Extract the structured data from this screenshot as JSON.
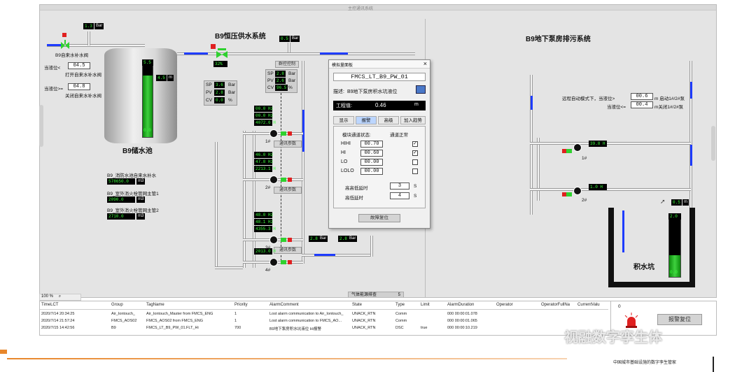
{
  "window": {
    "title": "主控通讯系统"
  },
  "left_section": {
    "title": "B9恒压供水系统",
    "tank_label": "B9储水池",
    "tank_level_big": "5.5",
    "tank_level_side": "4.5",
    "tank_level_side_unit": "m",
    "tank_bottom_value": "0.0",
    "tank_fill": 0.8,
    "inlet_pressure": "1.3",
    "inlet_pressure_unit": "Bar",
    "inlet_valve_label": "B9自来水补水阀",
    "open_level_prefix": "当液位<",
    "open_level_value": "04.5",
    "open_level_desc": "打开自来水补水阀",
    "close_level_prefix": "当液位>=",
    "close_level_value": "04.8",
    "close_level_desc": "关闭自来水补水阀",
    "main_valve_open": "32%",
    "outlet_pressure": "0.5",
    "outlet_pressure_unit": "Bar",
    "sp_label": "SP",
    "sp_value": "3.6",
    "sp_unit": "Bar",
    "pv_label": "PV",
    "pv_value": "2.8",
    "pv_unit": "Bar",
    "cv_label": "CV",
    "cv_value": "0.0",
    "cv_unit": "%",
    "panel2_title": "群控控制",
    "sp2_value": "2.8",
    "sp2_unit": "Bar",
    "pv2_value": "2.6",
    "pv2_unit": "Bar",
    "cv2_value": "96.5",
    "cv2_unit": "%",
    "meters": [
      {
        "label": "B9_消防水池自来水补水",
        "value": "578650.0",
        "unit": "m3"
      },
      {
        "label": "B9_室外消火栓管网主管1",
        "value": "2090.0",
        "unit": "m3"
      },
      {
        "label": "B9_室外消火栓管网主管2",
        "value": "2710.0",
        "unit": "m3"
      }
    ],
    "pumps": [
      {
        "id": "1#",
        "hz1": "00.0 Hz",
        "hz2": "00.0 Hz",
        "hours": "4072.6 H",
        "btn": "通讯参数"
      },
      {
        "id": "2#",
        "hz1": "46.0 Hz",
        "hz2": "47.8 Hz",
        "hours": "2213.1 H",
        "btn": "通讯参数"
      },
      {
        "id": "3#",
        "hz1": "48.0 Hz",
        "hz2": "48.1 Hz",
        "hours": "4355.3 H",
        "btn": "通讯参数"
      },
      {
        "id": "4#",
        "hz1": "",
        "hz2": "",
        "hours": "2013.0 H",
        "btn": ""
      }
    ],
    "bottom_pressure1": "2.8",
    "bottom_pressure1_unit": "Bar",
    "bottom_pressure2": "2.8",
    "bottom_pressure2_unit": "Bar",
    "energy_label": "气体能源排查",
    "energy_num": "5"
  },
  "dialog": {
    "title": "模拟量面板",
    "tag": "FMCS_LT_B9_PW_01",
    "desc_label": "描述:",
    "desc_value": "B9地下泵房积水坑液位",
    "eng_label": "工程值:",
    "eng_value": "0.46",
    "eng_unit": "m",
    "tabs": [
      "显示",
      "报警",
      "高级",
      "加入趋势"
    ],
    "status_label": "模块通道状态:",
    "status_value": "通道正常",
    "rows": [
      {
        "label": "HIHI",
        "value": "00.70",
        "checked": "✓"
      },
      {
        "label": "HI",
        "value": "00.60",
        "checked": "✓"
      },
      {
        "label": "LO",
        "value": "00.00",
        "checked": ""
      },
      {
        "label": "LOLO",
        "value": "00.00",
        "checked": ""
      }
    ],
    "delay_high_label": "高高低延时",
    "delay_high_value": "3",
    "delay_low_label": "高低延时",
    "delay_low_value": "4",
    "delay_unit": "S",
    "reset_btn": "故障复位",
    "close": "×"
  },
  "right_section": {
    "title": "B9地下泵房排污系统",
    "mode_text": "远程自动模式下，当液位>",
    "mode_value1": "00.6",
    "mode_desc1": "m 启动1#/2#泵",
    "mode_text2": "当液位<=",
    "mode_value2": "00.4",
    "mode_desc2": "m关闭1#/2#泵",
    "pump1_hours": "39.8 H",
    "pump1_id": "1#",
    "pump2_hours": "1.0 H",
    "pump2_id": "2#",
    "pit_level": "0.5",
    "pit_unit": "m",
    "pit_big": "2.0",
    "pit_bottom": "0.0",
    "pit_label": "积水坑",
    "pit_fill": 0.35
  },
  "alarm_table": {
    "zoom": "100 %",
    "headers": [
      "TimeLCT",
      "Group",
      "TagName",
      "Priority",
      "AlarmComment",
      "State",
      "Type",
      "Limit",
      "AlarmDuration",
      "Operator",
      "OperatorFullNa",
      "CurrentValu"
    ],
    "rows": [
      [
        "2020/7/14 20:34:25",
        "Air_Iontouch_",
        "Air_Iontouch_Master from FMCS_ENG",
        "1",
        "Lost alarm communication to Air_Iontouch_",
        "UNACK_RTN",
        "Comm",
        "",
        "000 00:00:01.078",
        "",
        "",
        ""
      ],
      [
        "2020/7/14 21:57:24",
        "FMCS_AOS02",
        "FMCS_AOS02 from FMCS_ENG",
        "1",
        "Lost alarm communication to FMCS_AO...",
        "UNACK_RTN",
        "Comm",
        "",
        "000 00:00:01.065",
        "",
        "",
        ""
      ],
      [
        "2020/7/15 14:42:56",
        "B9",
        "FMCS_LT_B9_PW_01.FLT_Hi",
        "700",
        "B9地下泵房积水坑液位 Hi报警",
        "UNACK_RTN",
        "DSC",
        "true",
        "000 00:00:10.219",
        "",
        "",
        ""
      ]
    ],
    "count": "0",
    "reset_btn": "报警复位"
  },
  "watermark": "视融数字孪生体",
  "footer": "中国城市基础设施的数字孪生管家"
}
